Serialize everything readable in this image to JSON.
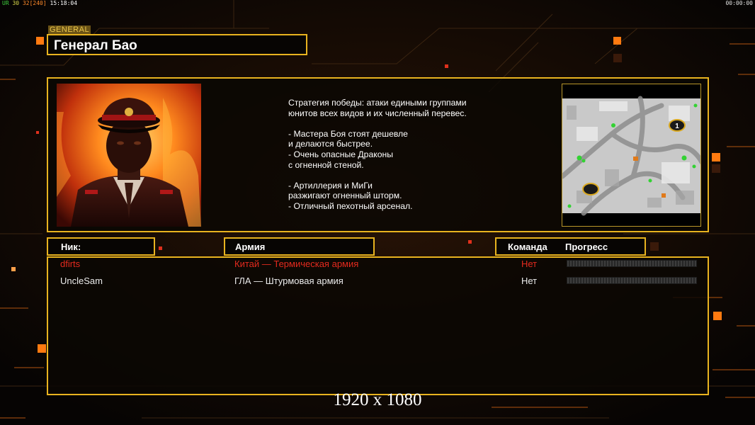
{
  "hud": {
    "left_tag": "UR",
    "fps": "30",
    "fps2": "32",
    "fps3": "[240]",
    "clock": "15:18:04",
    "timer": "00:00:00"
  },
  "general_tag": "GENERAL",
  "general_name": "Генерал Бао",
  "description": "Стратегия победы: атаки едиными группами\nюнитов всех видов и их численный перевес.\n\n- Мастера Боя стоят дешевле\nи делаются быстрее.\n- Очень опасные Драконы\nс огненной стеной.\n\n- Артиллерия и МиГи\nразжигают огненный шторм.\n- Отличный пехотный арсенал.",
  "minimap": {
    "start_marker": "1"
  },
  "columns": {
    "nick": "Ник:",
    "army": "Армия",
    "team": "Команда",
    "progress": "Прогресс"
  },
  "players": [
    {
      "nick": "dfirts",
      "army": "Китай — Термическая армия",
      "team": "Нет",
      "progress": 0,
      "color": "#e42a1e"
    },
    {
      "nick": "UncleSam",
      "army": "ГЛА — Штурмовая армия",
      "team": "Нет",
      "progress": 0,
      "color": "#ececec"
    }
  ],
  "resolution_label": "1920 x 1080",
  "colors": {
    "accent": "#e8b31f",
    "tag_bg": "#6b5316",
    "glow": "#ff6a00"
  }
}
